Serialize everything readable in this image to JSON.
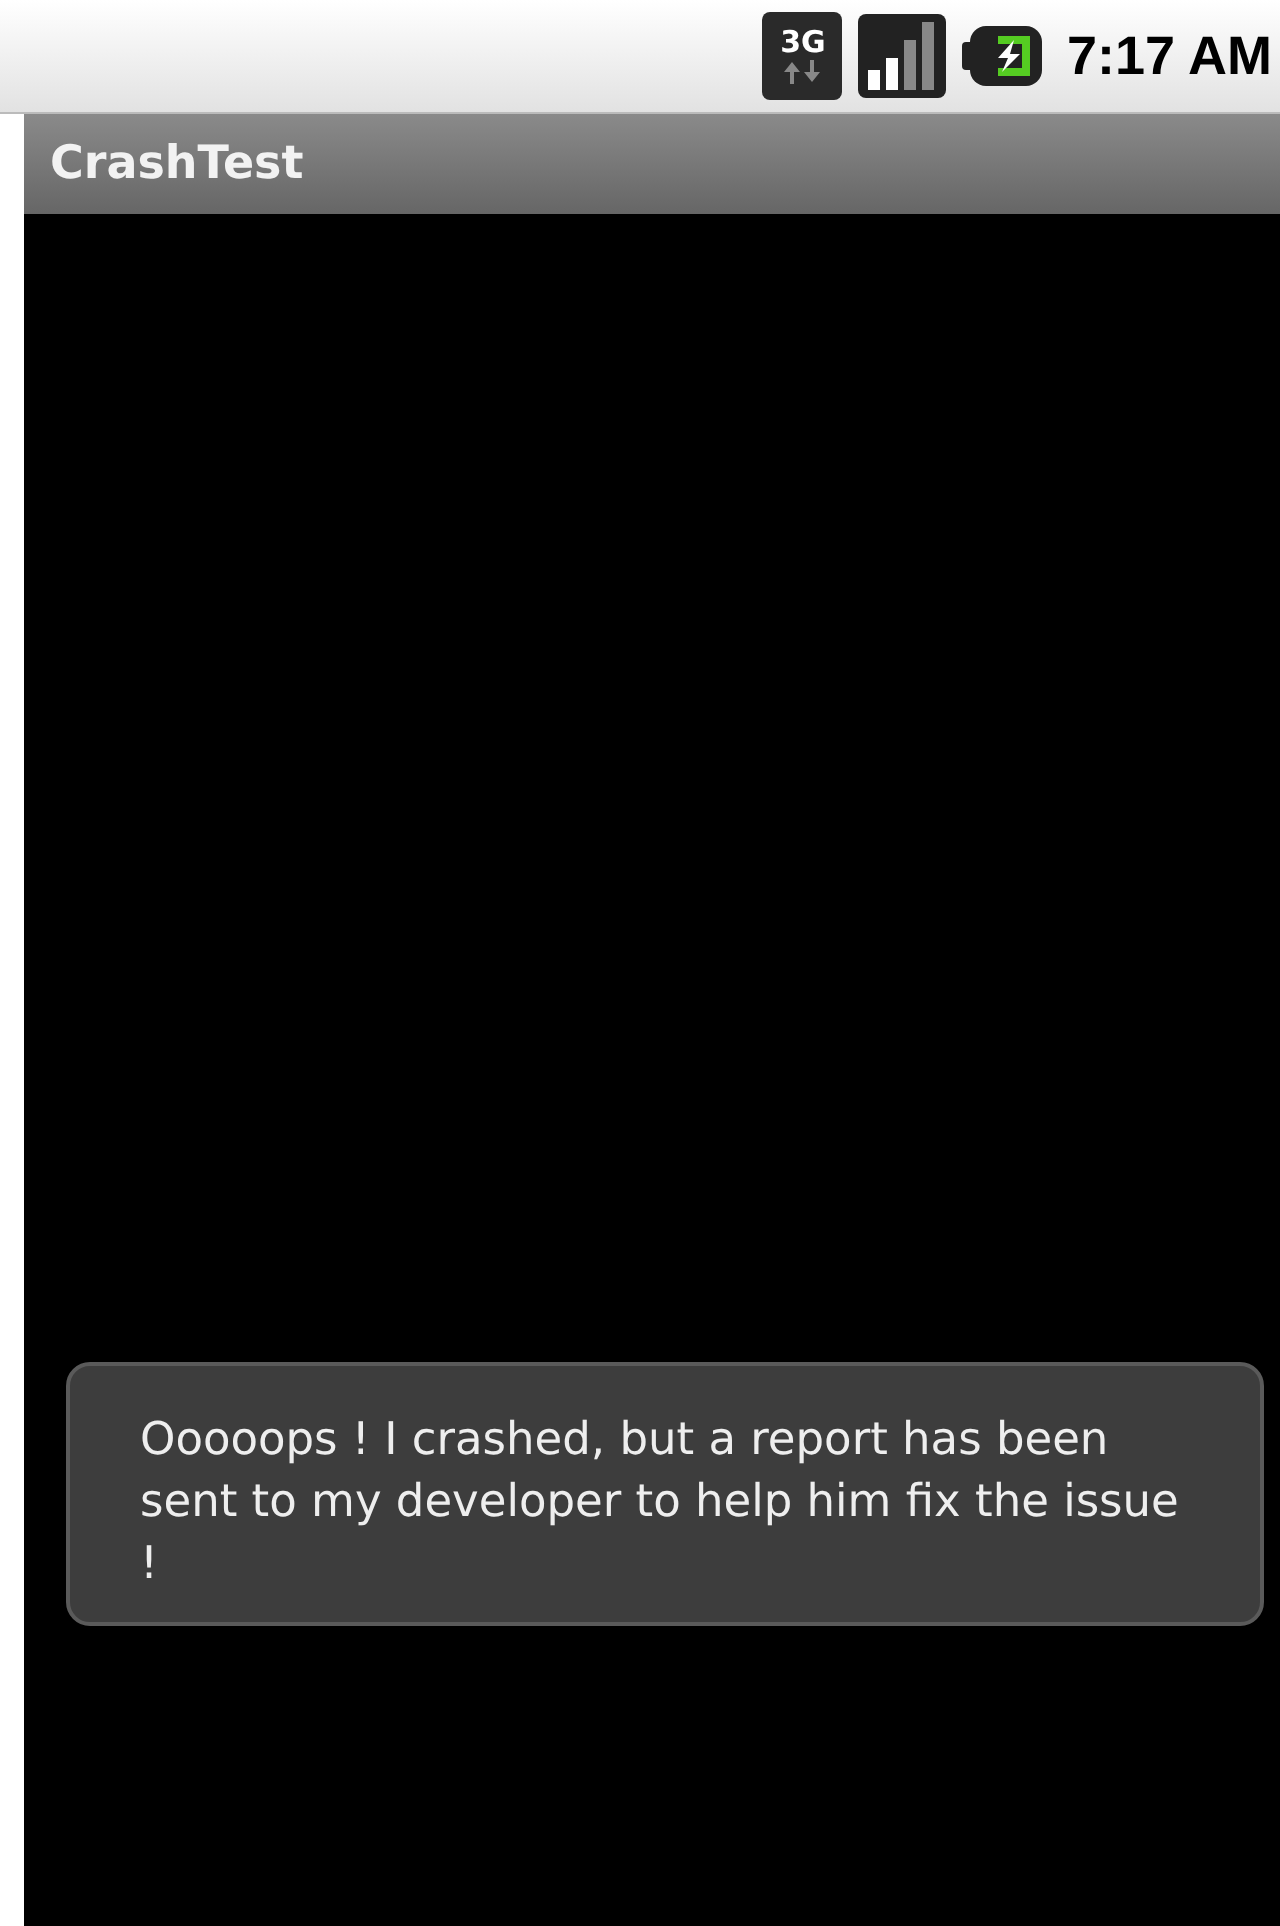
{
  "status_bar": {
    "network_type": "3G",
    "time": "7:17 AM"
  },
  "app": {
    "title": "CrashTest"
  },
  "toast": {
    "message": "Ooooops ! I crashed, but a report has been sent to my developer to help him fix the issue !"
  }
}
